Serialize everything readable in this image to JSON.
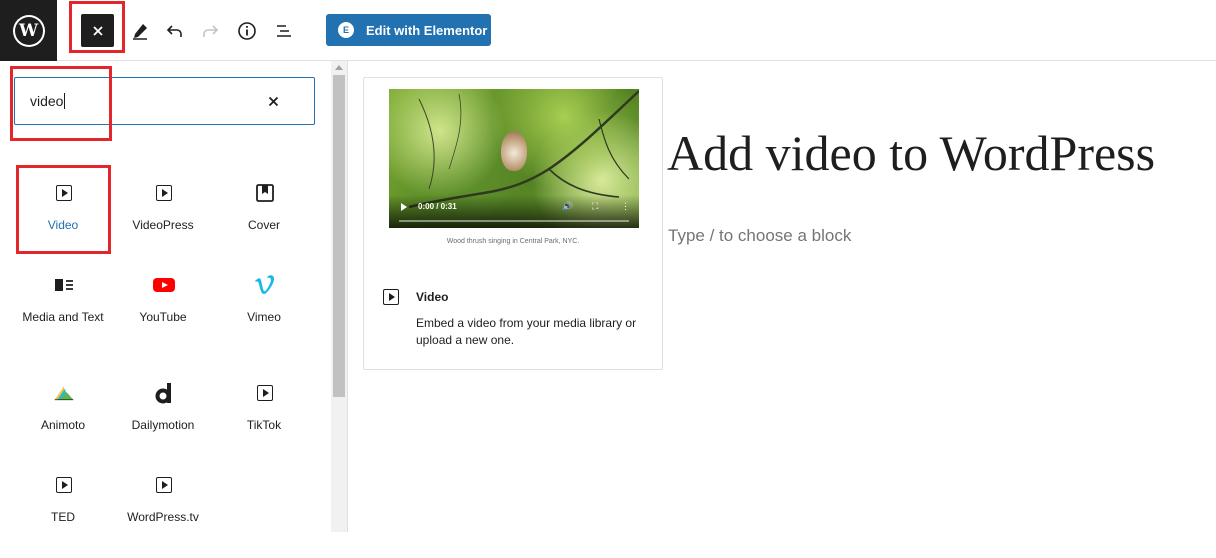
{
  "toolbar": {
    "logo_glyph": "W",
    "elementor_label": "Edit with Elementor",
    "elementor_icon_glyph": "E",
    "icons": [
      "wordpress-logo",
      "close-icon",
      "pencil-icon",
      "undo-icon",
      "redo-icon",
      "info-icon",
      "list-view-icon"
    ]
  },
  "inserter": {
    "search_value": "video",
    "blocks": [
      {
        "label": "Video",
        "icon": "video-icon",
        "active": true
      },
      {
        "label": "VideoPress",
        "icon": "videopress-icon"
      },
      {
        "label": "Cover",
        "icon": "cover-icon"
      },
      {
        "label": "Media and Text",
        "icon": "media-text-icon"
      },
      {
        "label": "YouTube",
        "icon": "youtube-icon"
      },
      {
        "label": "Vimeo",
        "icon": "vimeo-icon"
      },
      {
        "label": "Animoto",
        "icon": "animoto-icon"
      },
      {
        "label": "Dailymotion",
        "icon": "dailymotion-icon"
      },
      {
        "label": "TikTok",
        "icon": "tiktok-icon"
      },
      {
        "label": "TED",
        "icon": "ted-icon"
      },
      {
        "label": "WordPress.tv",
        "icon": "wordpress-tv-icon"
      }
    ]
  },
  "preview": {
    "video_time": "0:00 / 0:31",
    "caption": "Wood thrush singing in Central Park, NYC.",
    "title": "Video",
    "description": "Embed a video from your media library or upload a new one."
  },
  "editor": {
    "post_title": "Add video to WordPress",
    "block_placeholder": "Type / to choose a block"
  },
  "colors": {
    "accent": "#2271b1",
    "highlight": "#e3262a",
    "youtube": "#ff0000",
    "vimeo": "#1ab7ea",
    "dark": "#1e1e1e"
  }
}
